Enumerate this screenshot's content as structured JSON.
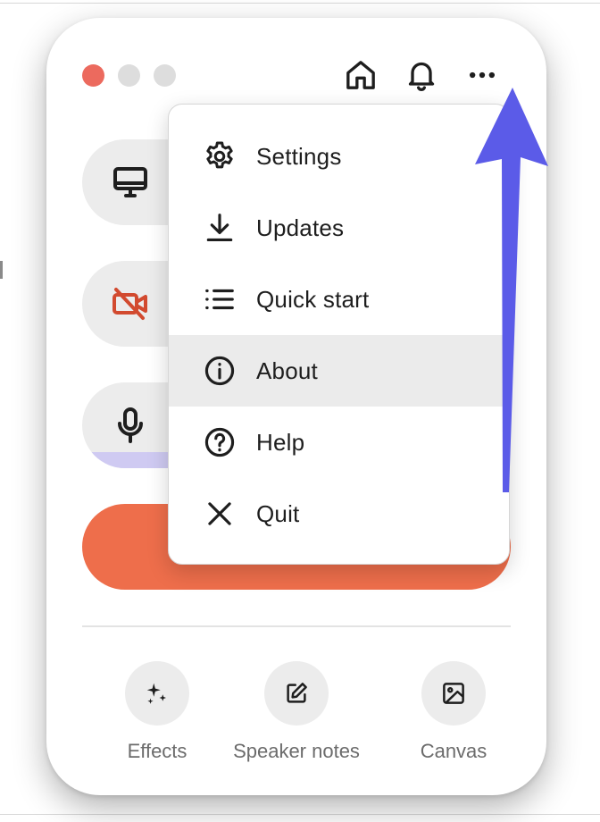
{
  "window": {
    "traffic_lights": [
      "close",
      "minimize",
      "maximize"
    ],
    "top_icons": [
      "home-icon",
      "bell-icon",
      "more-icon"
    ]
  },
  "main": {
    "pills": [
      {
        "icon": "monitor-icon"
      },
      {
        "icon": "camera-off-icon",
        "status_color": "#d24a2f"
      },
      {
        "icon": "microphone-icon",
        "level_color": "#cfcaf2"
      }
    ],
    "record_color": "#ee6e4b"
  },
  "menu": {
    "items": [
      {
        "label": "Settings",
        "icon": "gear-icon"
      },
      {
        "label": "Updates",
        "icon": "download-icon"
      },
      {
        "label": "Quick start",
        "icon": "list-icon"
      },
      {
        "label": "About",
        "icon": "info-icon",
        "highlighted": true
      },
      {
        "label": "Help",
        "icon": "help-icon"
      },
      {
        "label": "Quit",
        "icon": "close-icon"
      }
    ]
  },
  "tools": [
    {
      "label": "Effects",
      "icon": "sparkles-icon"
    },
    {
      "label": "Speaker notes",
      "icon": "edit-icon"
    },
    {
      "label": "Canvas",
      "icon": "image-icon"
    }
  ],
  "annotation": {
    "arrow_color": "#5b5be8"
  }
}
